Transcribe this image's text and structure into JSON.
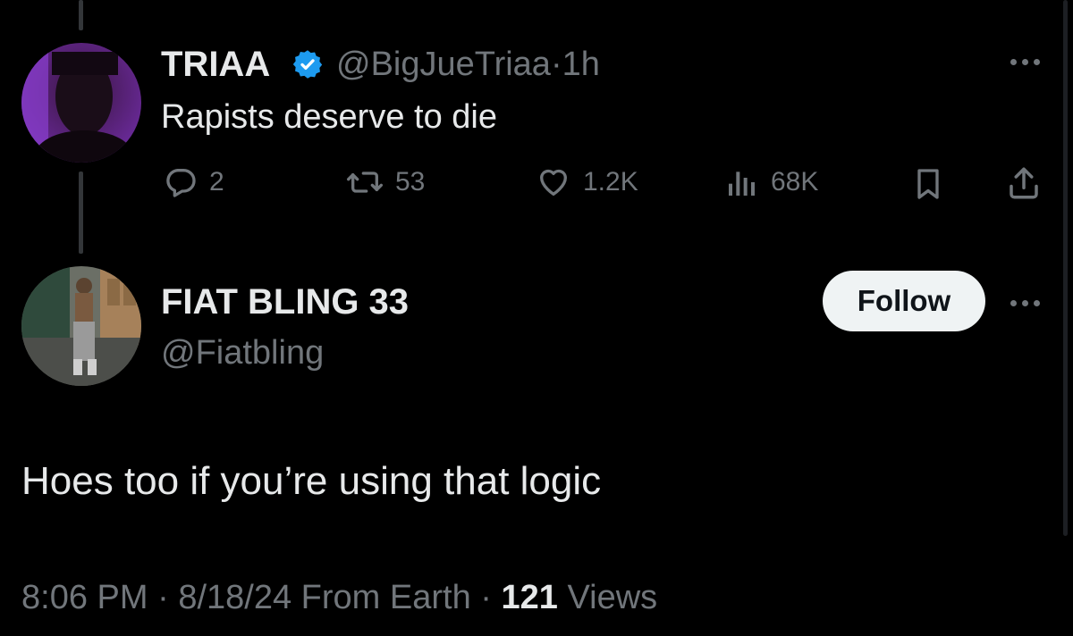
{
  "original_tweet": {
    "display_name": "TRIAA",
    "handle": "@BigJueTriaa",
    "separator": "·",
    "time": "1h",
    "text": "Rapists deserve to die",
    "replies": "2",
    "reposts": "53",
    "likes": "1.2K",
    "views": "68K",
    "verified_badge_color": "#1d9bf0"
  },
  "reply_tweet": {
    "display_name": "FIAT BLING 33",
    "handle": "@Fiatbling",
    "follow_label": "Follow",
    "text": "Hoes too if you’re using that logic",
    "meta": {
      "time": "8:06 PM",
      "sep1": "·",
      "date": "8/18/24",
      "source": "From Earth",
      "sep2": "·",
      "views_count": "121",
      "views_label": "Views"
    }
  },
  "icons": [
    "reply-icon",
    "repost-icon",
    "like-icon",
    "views-icon",
    "bookmark-icon",
    "share-icon",
    "more-icon",
    "verified-icon"
  ],
  "colors": {
    "background": "#000000",
    "text": "#e7e9ea",
    "muted": "#71767b",
    "follow_bg": "#eff3f4"
  }
}
